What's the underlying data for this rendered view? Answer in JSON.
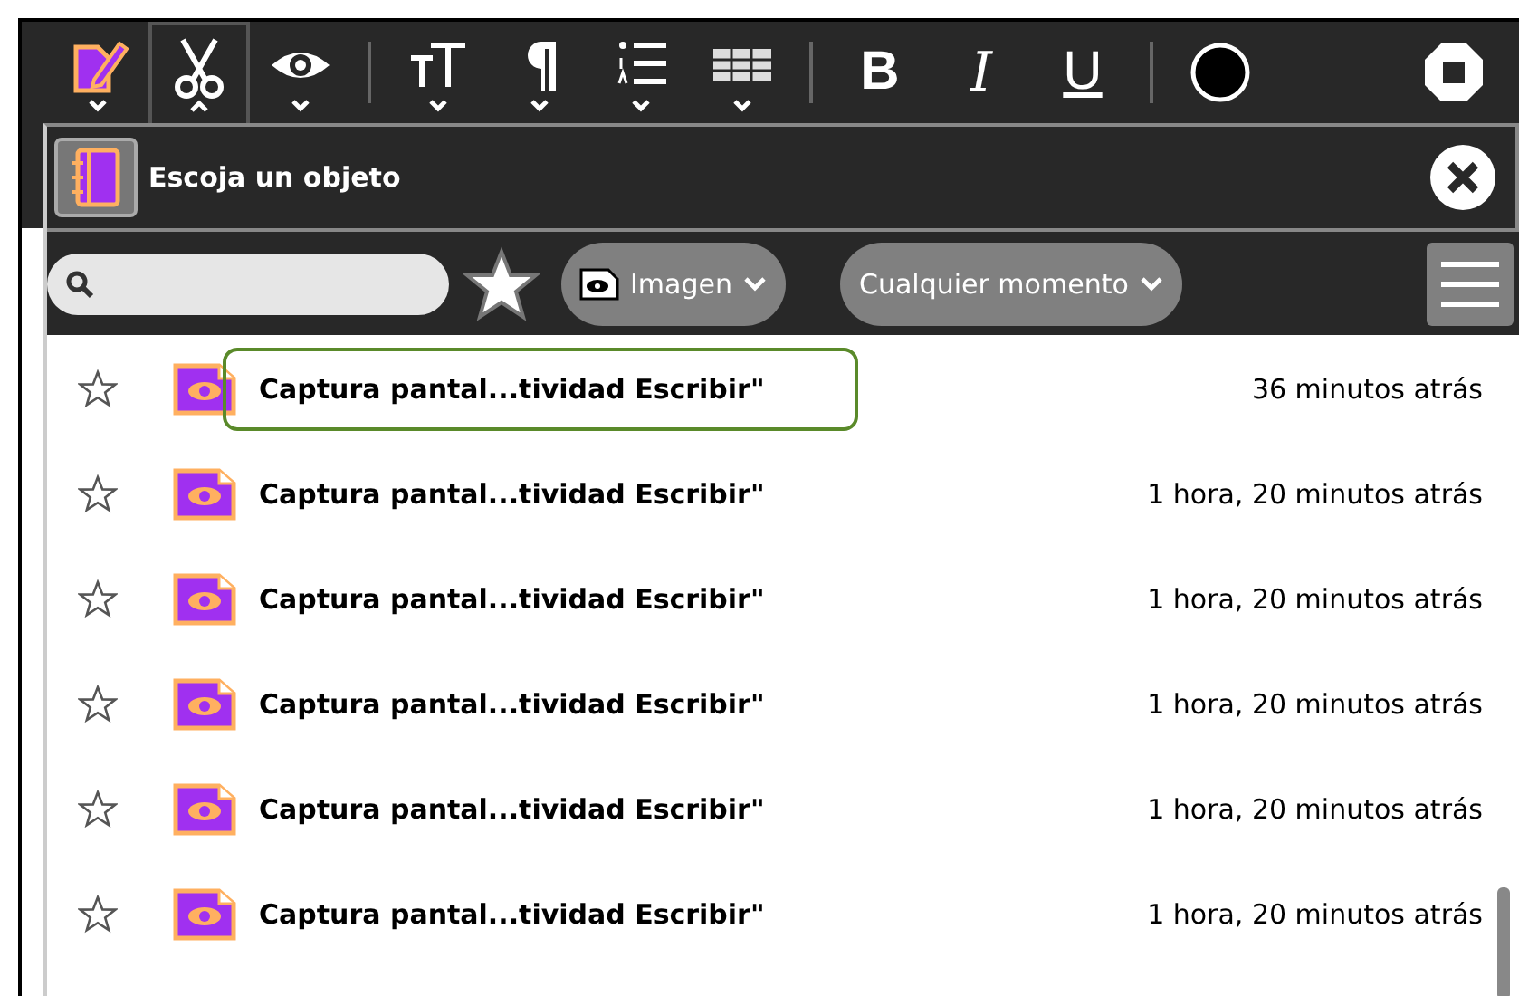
{
  "toolbar": {
    "tools": [
      {
        "kind": "activity",
        "expanded": false,
        "selected": false
      },
      {
        "kind": "scissors",
        "expanded": true,
        "selected": true
      },
      {
        "kind": "eye",
        "expanded": false,
        "selected": false
      },
      {
        "kind": "separator"
      },
      {
        "kind": "text-size",
        "expanded": false,
        "selected": false
      },
      {
        "kind": "paragraph",
        "expanded": false,
        "selected": false
      },
      {
        "kind": "list",
        "expanded": false,
        "selected": false
      },
      {
        "kind": "table",
        "expanded": false,
        "selected": false
      },
      {
        "kind": "separator"
      },
      {
        "kind": "bold",
        "label": "B",
        "selected": false
      },
      {
        "kind": "italic",
        "label": "I",
        "selected": false
      },
      {
        "kind": "underline",
        "label": "U",
        "selected": false
      },
      {
        "kind": "separator"
      },
      {
        "kind": "color",
        "color": "#000000"
      },
      {
        "kind": "spacer"
      },
      {
        "kind": "stop"
      }
    ]
  },
  "dialog": {
    "title": "Escoja un objeto",
    "filters": {
      "favorites_only": false,
      "type": "Imagen",
      "time": "Cualquier momento"
    },
    "entries": [
      {
        "title": "Captura pantal...tividad Escribir\"",
        "time": "36 minutos atrás",
        "starred": false,
        "selected": true
      },
      {
        "title": "Captura pantal...tividad Escribir\"",
        "time": "1 hora, 20 minutos atrás",
        "starred": false,
        "selected": false
      },
      {
        "title": "Captura pantal...tividad Escribir\"",
        "time": "1 hora, 20 minutos atrás",
        "starred": false,
        "selected": false
      },
      {
        "title": "Captura pantal...tividad Escribir\"",
        "time": "1 hora, 20 minutos atrás",
        "starred": false,
        "selected": false
      },
      {
        "title": "Captura pantal...tividad Escribir\"",
        "time": "1 hora, 20 minutos atrás",
        "starred": false,
        "selected": false
      },
      {
        "title": "Captura pantal...tividad Escribir\"",
        "time": "1 hora, 20 minutos atrás",
        "starred": false,
        "selected": false
      }
    ]
  }
}
